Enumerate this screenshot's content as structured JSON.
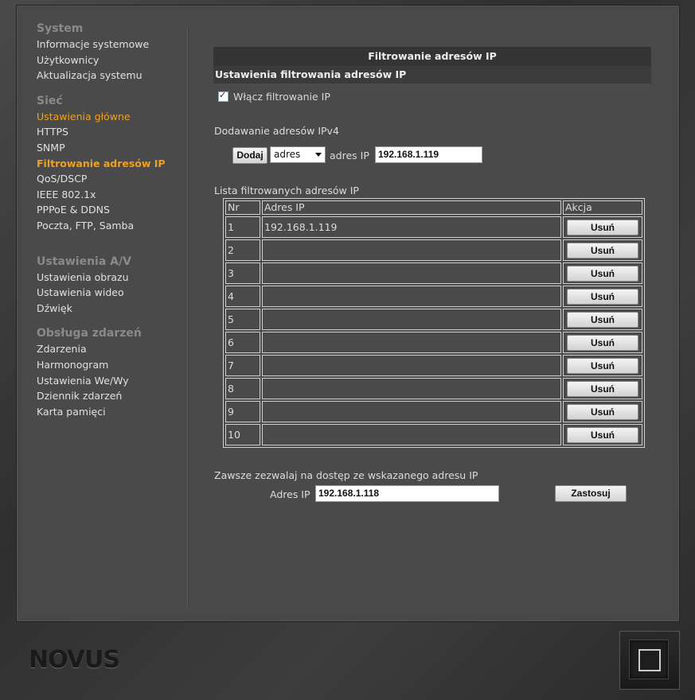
{
  "sidebar": {
    "system": {
      "title": "System",
      "items": [
        "Informacje systemowe",
        "Użytkownicy",
        "Aktualizacja systemu"
      ]
    },
    "network": {
      "title": "Sieć",
      "items": [
        "Ustawienia główne",
        "HTTPS",
        "SNMP",
        "Filtrowanie adresów IP",
        "QoS/DSCP",
        "IEEE 802.1x",
        "PPPoE & DDNS",
        "Poczta, FTP, Samba"
      ]
    },
    "av": {
      "title": "Ustawienia A/V",
      "items": [
        "Ustawienia obrazu",
        "Ustawienia wideo",
        "Dźwięk"
      ]
    },
    "events": {
      "title": "Obsługa zdarzeń",
      "items": [
        "Zdarzenia",
        "Harmonogram",
        "Ustawienia We/Wy",
        "Dziennik zdarzeń",
        "Karta pamięci"
      ]
    }
  },
  "page": {
    "title": "Filtrowanie adresów IP",
    "section_title": "Ustawienia filtrowania adresów IP",
    "enable_label": "Włącz filtrowanie IP",
    "add_section": "Dodawanie adresów IPv4",
    "add_button": "Dodaj",
    "type_select": "adres",
    "ip_label": "adres IP",
    "ip_value": "192.168.1.119",
    "list_title": "Lista filtrowanych adresów IP",
    "table": {
      "headers": [
        "Nr",
        "Adres IP",
        "Akcja"
      ],
      "remove_label": "Usuń",
      "rows": [
        {
          "nr": "1",
          "ip": "192.168.1.119"
        },
        {
          "nr": "2",
          "ip": ""
        },
        {
          "nr": "3",
          "ip": ""
        },
        {
          "nr": "4",
          "ip": ""
        },
        {
          "nr": "5",
          "ip": ""
        },
        {
          "nr": "6",
          "ip": ""
        },
        {
          "nr": "7",
          "ip": ""
        },
        {
          "nr": "8",
          "ip": ""
        },
        {
          "nr": "9",
          "ip": ""
        },
        {
          "nr": "10",
          "ip": ""
        }
      ]
    },
    "always_allow_label": "Zawsze zezwalaj na dostęp ze wskazanego adresu IP",
    "always_ip_label": "Adres IP",
    "always_ip_value": "192.168.1.118",
    "apply_button": "Zastosuj"
  },
  "footer": {
    "logo": "NOVUS"
  },
  "colors": {
    "active": "#f0a020",
    "background": "#4a4a4a"
  }
}
